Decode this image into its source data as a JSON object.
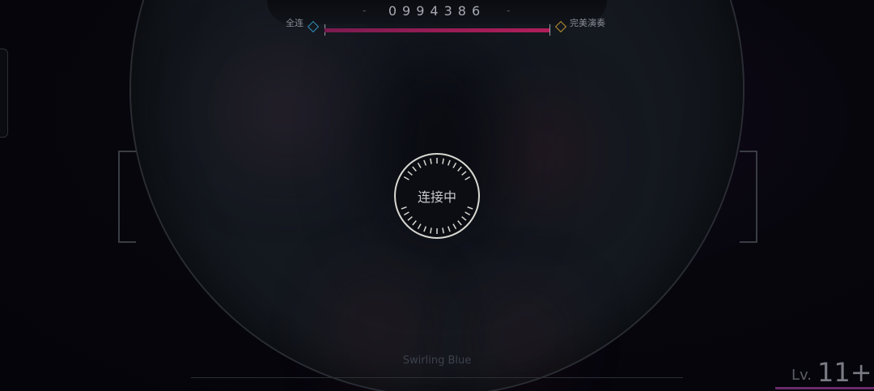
{
  "hud": {
    "score": "0994386",
    "full_combo_label": "全连",
    "all_perfect_label": "完美演奏",
    "progress_fraction": 1.0
  },
  "status": {
    "connecting_text": "连接中"
  },
  "song": {
    "title": "Swirling Blue"
  },
  "difficulty": {
    "prefix": "Lv.",
    "level": "11+"
  },
  "colors": {
    "progress": "#b01e5a",
    "full_combo_marker": "#2f8fb8",
    "all_perfect_marker": "#b8922f",
    "level_bar": "#6a2a6a"
  }
}
